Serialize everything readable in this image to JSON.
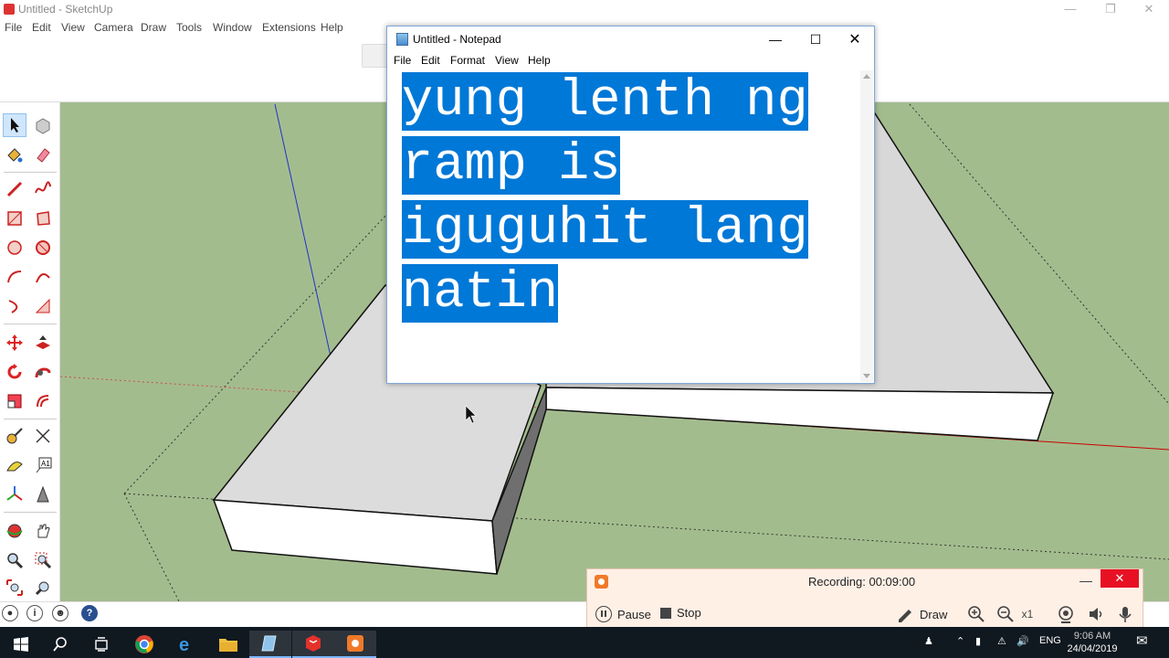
{
  "sketchup": {
    "title": "Untitled - SketchUp",
    "menu": [
      "File",
      "Edit",
      "View",
      "Camera",
      "Draw",
      "Tools",
      "Window",
      "Extensions",
      "Help"
    ]
  },
  "notepad": {
    "title": "Untitled - Notepad",
    "menu": [
      "File",
      "Edit",
      "Format",
      "View",
      "Help"
    ],
    "lines": [
      "yung lenth ng",
      "ramp is",
      "iguguhit lang",
      "natin"
    ]
  },
  "recorder": {
    "status": "Recording:  00:09:00",
    "pause_label": "Pause",
    "stop_label": "Stop",
    "draw_label": "Draw",
    "zoom_label": "x1"
  },
  "taskbar": {
    "lang": "ENG",
    "time": "9:06 AM",
    "date": "24/04/2019"
  },
  "colors": {
    "viewport_ground": "#a3bc8e",
    "selection": "#0078d7",
    "recorder_bg": "#fff0e6",
    "close_red": "#e81123"
  }
}
